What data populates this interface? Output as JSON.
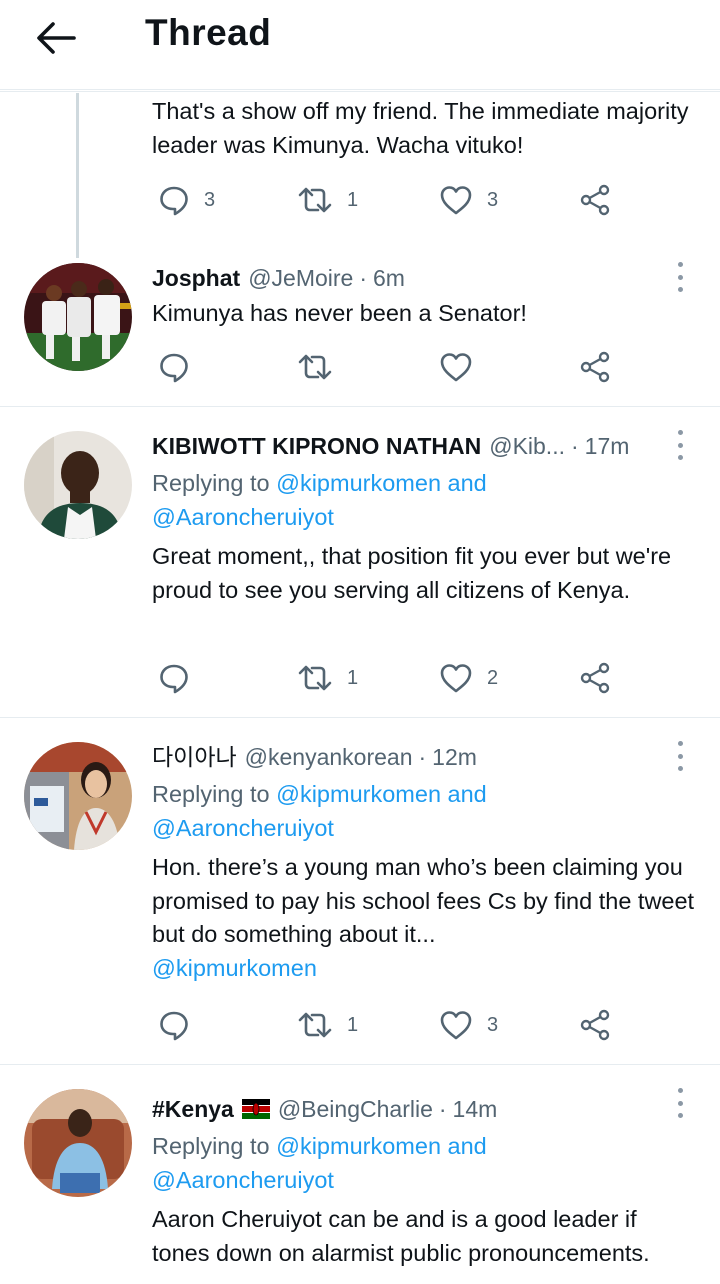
{
  "header": {
    "title": "Thread",
    "back_icon": "arrow-left-icon"
  },
  "tweets": [
    {
      "text": "That's a show off my friend. The immediate majority leader was Kimunya. Wacha vituko!",
      "replies": "3",
      "retweets": "1",
      "likes": "3"
    },
    {
      "name": "Josphat",
      "handle": "@JeMoire",
      "sep": "·",
      "time": "6m",
      "text": "Kimunya has never been a Senator!",
      "replies": "",
      "retweets": "",
      "likes": ""
    },
    {
      "name": "KIBIWOTT KIPRONO NATHAN",
      "handle": "@Kib...",
      "sep": "·",
      "time": "17m",
      "replying_prefix": "Replying to",
      "replying_to": "@kipmurkomen and",
      "replying_to2": "@Aaroncheruiyot",
      "text": "Great moment,, that position fit you ever but we're proud to see you serving all citizens of Kenya.",
      "replies": "",
      "retweets": "1",
      "likes": "2"
    },
    {
      "name": "다이아나",
      "handle": "@kenyankorean",
      "sep": "·",
      "time": "12m",
      "replying_prefix": "Replying to",
      "replying_to": "@kipmurkomen and",
      "replying_to2": "@Aaroncheruiyot",
      "text": "Hon. there’s a young man who’s been claiming you promised to pay his school fees Cs by find the tweet but do something about it...",
      "mention": "@kipmurkomen",
      "replies": "",
      "retweets": "1",
      "likes": "3"
    },
    {
      "name": "#Kenya",
      "handle": "@BeingCharlie",
      "sep": "·",
      "time": "14m",
      "replying_prefix": "Replying to",
      "replying_to": "@kipmurkomen and",
      "replying_to2": "@Aaroncheruiyot",
      "text": "Aaron Cheruiyot can be and is a good leader if tones down on alarmist public pronouncements.",
      "flag_icon": "kenya-flag-icon"
    }
  ],
  "colors": {
    "accent": "#1d9bf0",
    "muted": "#536471",
    "divider": "#e6ecf0",
    "text": "#0f1419"
  }
}
